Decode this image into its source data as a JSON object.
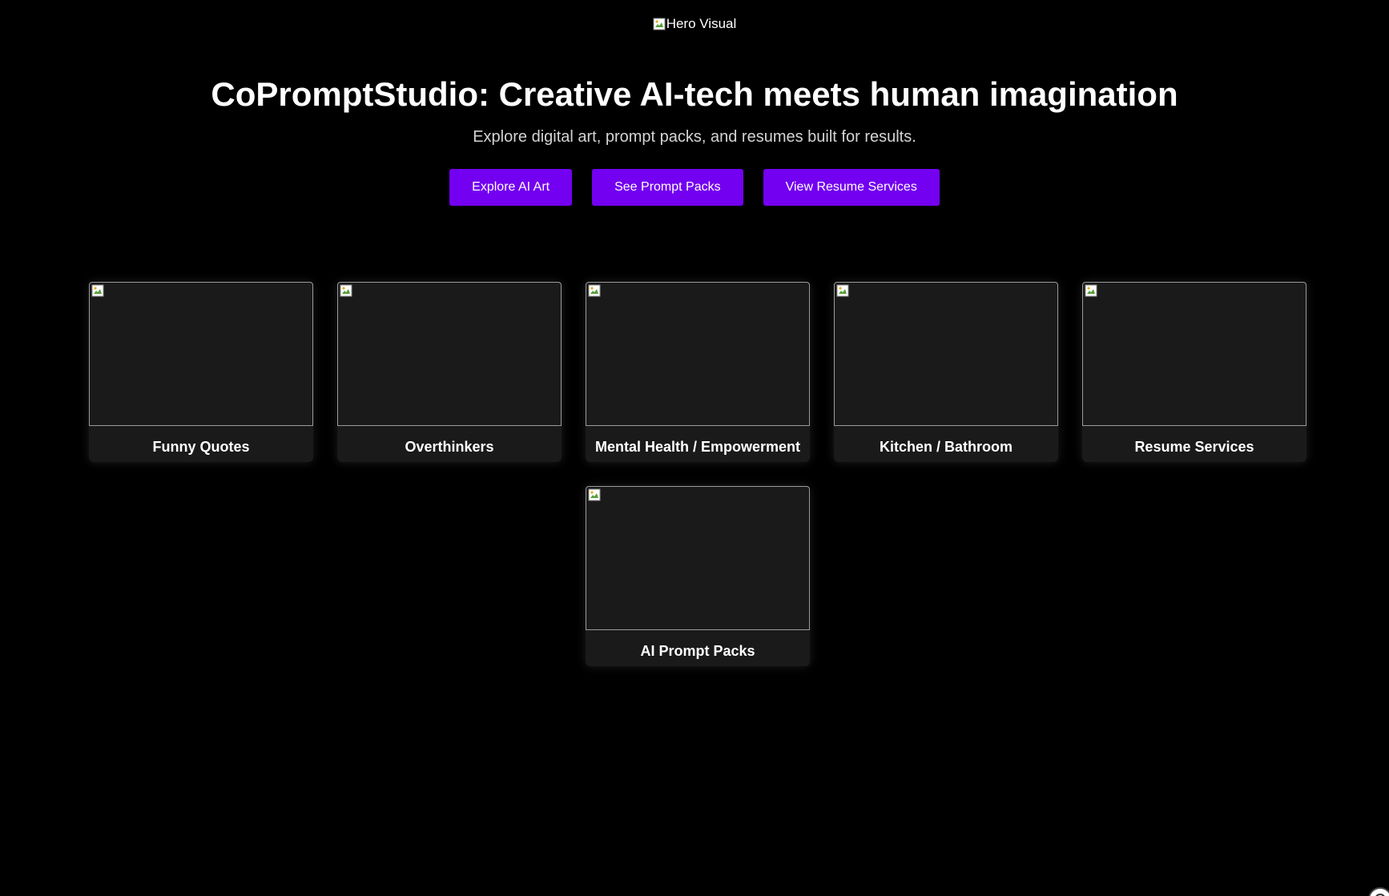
{
  "hero": {
    "image_alt": "Hero Visual",
    "title": "CoPromptStudio: Creative AI-tech meets human imagination",
    "subtitle": "Explore digital art, prompt packs, and resumes built for results."
  },
  "cta_buttons": [
    {
      "label": "Explore AI Art"
    },
    {
      "label": "See Prompt Packs"
    },
    {
      "label": "View Resume Services"
    }
  ],
  "categories": [
    {
      "title": "Funny Quotes"
    },
    {
      "title": "Overthinkers"
    },
    {
      "title": "Mental Health / Empowerment"
    },
    {
      "title": "Kitchen / Bathroom"
    },
    {
      "title": "Resume Services"
    },
    {
      "title": "AI Prompt Packs"
    }
  ],
  "colors": {
    "background": "#000000",
    "accent": "#7300f0",
    "card_background": "#1a1a1a",
    "text": "#ffffff",
    "muted_text": "#d4d4d4"
  },
  "icons": {
    "broken_image": "broken-image-icon",
    "corner_widget": "chat-widget-icon"
  }
}
